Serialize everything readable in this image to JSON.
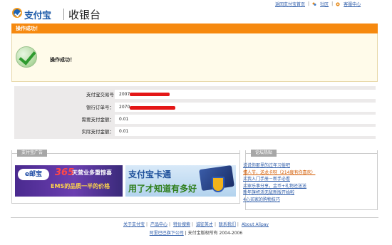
{
  "header": {
    "logo_text": "支付宝",
    "title": "收银台",
    "top_links": [
      "返回支付宝首页",
      "社区",
      "客服中心"
    ]
  },
  "success_bar": {
    "label": "操作成功！"
  },
  "success_message": "操作成功！",
  "details": [
    {
      "label": "支付宝交易号",
      "value": "2007"
    },
    {
      "label": "银行订单号：",
      "value": "2070"
    },
    {
      "label": "需要支付金额：",
      "value": "0.01"
    },
    {
      "label": "实际支付金额：",
      "value": "0.01"
    }
  ],
  "ad_panel": {
    "title": "支付宝广告",
    "ems": {
      "logo": "e邮宝",
      "number": "365",
      "line1": "天营业多重惊喜",
      "line2": "EMS的品质一半的价格"
    },
    "card": {
      "line1": "支付宝卡通",
      "line2": "用了才知道有多好"
    }
  },
  "forum_panel": {
    "title": "论坛热贴",
    "items": [
      {
        "text": "说说你那里的过年习俗吧",
        "hot": false
      },
      {
        "text": "懂人节，送龙卡呀（214度有你喜欢）",
        "hot": true
      },
      {
        "text": "买我入门手册－新手必看",
        "hot": false
      },
      {
        "text": "买家乐事分享，金币+礼物还送送",
        "hot": false
      },
      {
        "text": "新年旗帜活无敌新版开始啦",
        "hot": false
      },
      {
        "text": "4心买家的购物技巧",
        "hot": false
      }
    ]
  },
  "footer": {
    "links": [
      "关于支付宝",
      "产品中心",
      "特价搜索",
      "诚征英才",
      "联系我们",
      "About Alipay"
    ],
    "company": "阿里巴巴旗下公司",
    "copyright": "支付宝版权所有 2004-2006"
  },
  "colors": {
    "accent_orange": "#f6890f",
    "link_blue": "#2b5aa8",
    "redaction_red": "#e41717"
  }
}
